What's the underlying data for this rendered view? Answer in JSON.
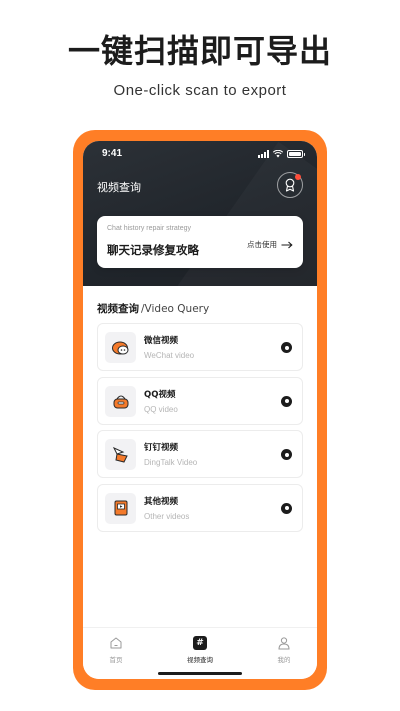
{
  "promo_banner": {
    "headline": "一键扫描即可导出",
    "subline": "One-click scan to export"
  },
  "status_bar": {
    "time": "9:41"
  },
  "header": {
    "title": "视频查询"
  },
  "promo_card": {
    "subtitle": "Chat history repair strategy",
    "title": "聊天记录修复攻略",
    "action_label": "点击使用"
  },
  "section": {
    "title_cn": "视频查询",
    "title_en": "/Video Query"
  },
  "items": [
    {
      "title": "微信视频",
      "subtitle": "WeChat video",
      "icon": "wechat-icon"
    },
    {
      "title": "QQ视频",
      "subtitle": "QQ video",
      "icon": "qq-icon"
    },
    {
      "title": "钉钉视频",
      "subtitle": "DingTalk Video",
      "icon": "dingtalk-icon"
    },
    {
      "title": "其他视频",
      "subtitle": "Other videos",
      "icon": "other-video-icon"
    }
  ],
  "tabbar": {
    "tabs": [
      {
        "label": "首页",
        "icon": "home-icon"
      },
      {
        "label": "视频查询",
        "icon": "hash-icon",
        "active": true
      },
      {
        "label": "我的",
        "icon": "user-icon"
      }
    ]
  },
  "colors": {
    "accent": "#ff7e26",
    "header_dark": "#24292f",
    "text_dark": "#1c1c1c",
    "muted": "#b5b5b5"
  }
}
